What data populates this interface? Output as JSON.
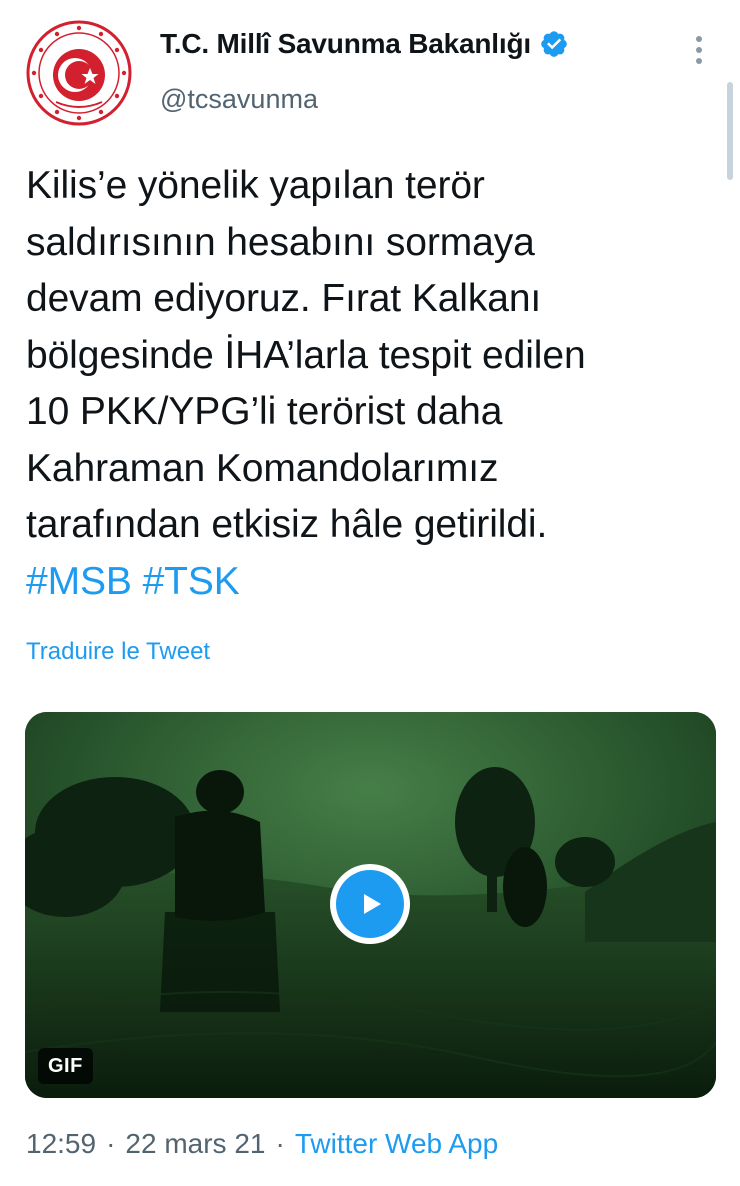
{
  "author": {
    "display_name": "T.C. Millî Savunma Bakanlığı",
    "handle": "@tcsavunma",
    "verified_icon": "verified-badge-icon",
    "avatar": "ministry-emblem-logo"
  },
  "tweet": {
    "lines": [
      "Kilis’e yönelik yapılan terör",
      "saldırısının hesabını sormaya",
      "devam ediyoruz. Fırat Kalkanı",
      "bölgesinde İHA’larla tespit edilen",
      "10 PKK/YPG’li terörist daha",
      "Kahraman Komandolarımız",
      "tarafından etkisiz hâle getirildi."
    ],
    "hashtags": [
      "#MSB",
      "#TSK"
    ],
    "translate_label": "Traduire le Tweet"
  },
  "media": {
    "badge": "GIF",
    "play_icon": "play-icon"
  },
  "meta": {
    "time": "12:59",
    "separator": "·",
    "date": "22 mars 21",
    "source": "Twitter Web App"
  },
  "colors": {
    "link": "#1d9bf0",
    "text": "#0f1419",
    "secondary": "#536471",
    "emblem_red": "#d3202f"
  }
}
